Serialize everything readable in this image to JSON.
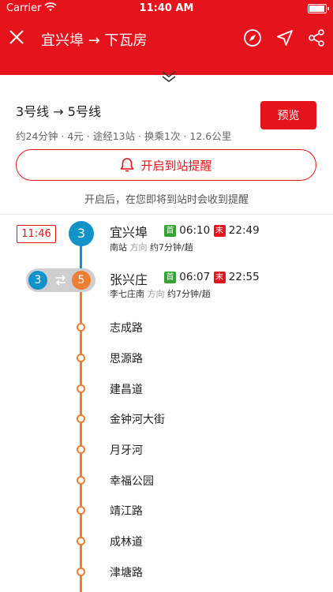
{
  "status_bar": {
    "carrier": "Carrier",
    "time": "11:40 AM",
    "battery_level": 0.95
  },
  "nav": {
    "title": "宜兴埠 → 下瓦房"
  },
  "summary": {
    "route": "3号线 → 5号线",
    "meta": "约24分钟 · 4元 · 途经13站 · 换乘1次 · 12.6公里",
    "preview_label": "预览"
  },
  "alert": {
    "button_label": "开启到站提醒",
    "note": "开启后，在您即将到站时会收到提醒"
  },
  "colors": {
    "brand": "#e5141c",
    "line3": "#1192c8",
    "line5": "#ee7e33",
    "first_tag": "#34a534"
  },
  "departure_time": "11:46",
  "stations": [
    {
      "line": "3",
      "name": "宜兴埠",
      "first_tag": "首",
      "first_time": "06:10",
      "last_tag": "末",
      "last_time": "22:49",
      "direction_station": "南站",
      "direction_label": "方向",
      "frequency": "约7分钟/趟"
    },
    {
      "line_from": "3",
      "line_to": "5",
      "name": "张兴庄",
      "first_tag": "首",
      "first_time": "06:07",
      "last_tag": "末",
      "last_time": "22:55",
      "direction_station": "李七庄南",
      "direction_label": "方向",
      "frequency": "约7分钟/趟"
    }
  ],
  "stops": [
    "志成路",
    "思源路",
    "建昌道",
    "金钟河大街",
    "月牙河",
    "幸福公园",
    "靖江路",
    "成林道",
    "津塘路"
  ]
}
